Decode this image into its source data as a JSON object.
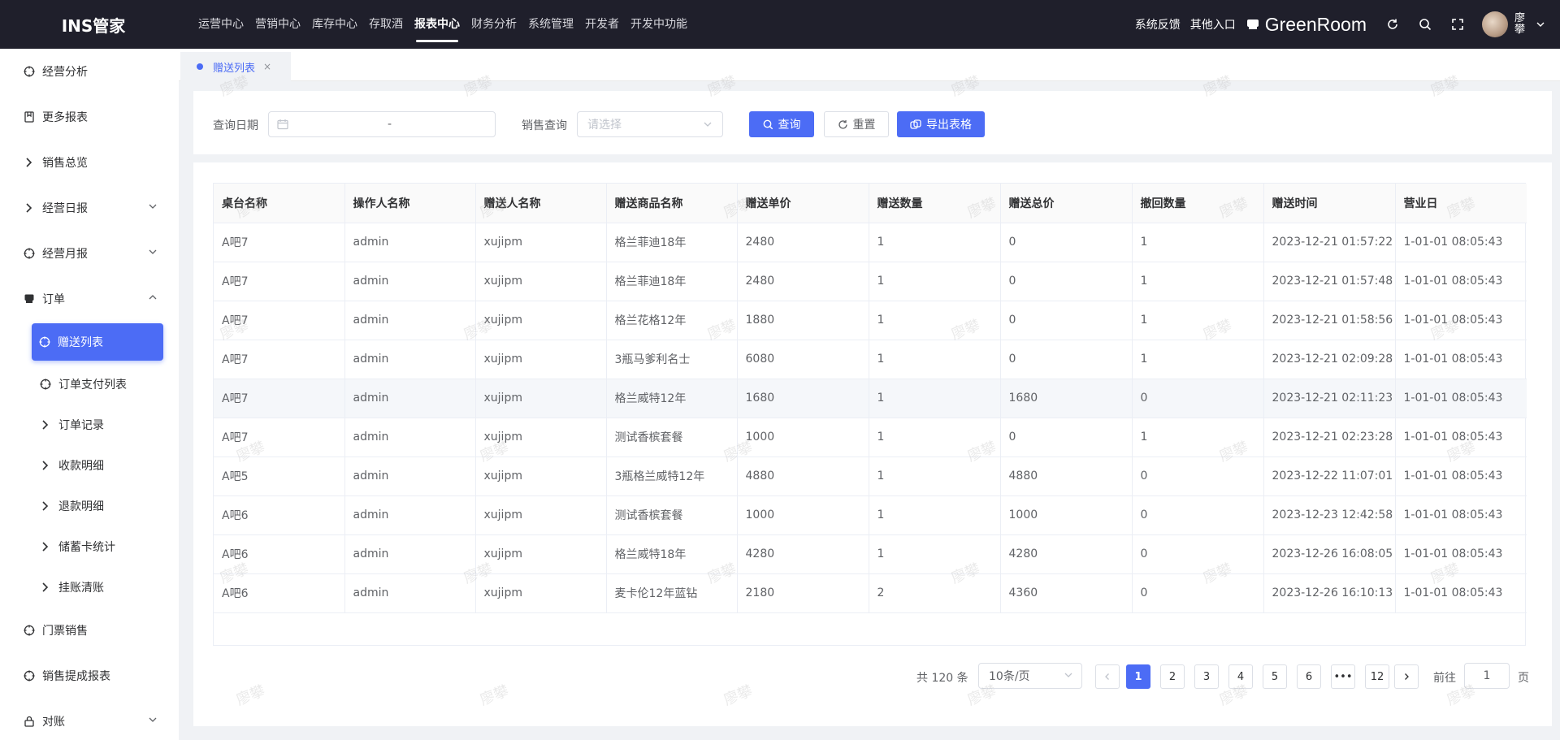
{
  "app": {
    "logo": "INS管家"
  },
  "topnav": [
    "运营中心",
    "营销中心",
    "库存中心",
    "存取酒",
    "报表中心",
    "财务分析",
    "系统管理",
    "开发者",
    "开发中功能"
  ],
  "topnav_active": "报表中心",
  "topright": {
    "feedback": "系统反馈",
    "other_entry": "其他入口",
    "store_name": "GreenRoom",
    "user_name": "廖攀"
  },
  "sidebar": {
    "items": [
      {
        "label": "经营分析",
        "icon": "target-icon"
      },
      {
        "label": "更多报表",
        "icon": "bookmark-icon"
      },
      {
        "label": "销售总览",
        "icon": "chevron-right-icon"
      },
      {
        "label": "经营日报",
        "icon": "chevron-right-icon",
        "arrow": "down"
      },
      {
        "label": "经营月报",
        "icon": "target-icon",
        "arrow": "down"
      },
      {
        "label": "订单",
        "icon": "box-icon",
        "arrow": "up"
      },
      {
        "label": "赠送列表",
        "icon": "target-icon",
        "active": true
      },
      {
        "label": "订单支付列表",
        "icon": "target-icon"
      },
      {
        "label": "订单记录",
        "icon": "chevron-right-icon"
      },
      {
        "label": "收款明细",
        "icon": "chevron-right-icon"
      },
      {
        "label": "退款明细",
        "icon": "chevron-right-icon"
      },
      {
        "label": "储蓄卡统计",
        "icon": "chevron-right-icon"
      },
      {
        "label": "挂账清账",
        "icon": "chevron-right-icon"
      },
      {
        "label": "门票销售",
        "icon": "target-icon"
      },
      {
        "label": "销售提成报表",
        "icon": "target-icon"
      },
      {
        "label": "对账",
        "icon": "lock-icon",
        "arrow": "down"
      }
    ]
  },
  "tabs": [
    {
      "label": "赠送列表",
      "close": "×"
    }
  ],
  "filter": {
    "date_label": "查询日期",
    "date_separator": "-",
    "sales_label": "销售查询",
    "sales_placeholder": "请选择",
    "query_button": "查询",
    "reset_button": "重置",
    "export_button": "导出表格"
  },
  "table": {
    "columns": [
      "桌台名称",
      "操作人名称",
      "赠送人名称",
      "赠送商品名称",
      "赠送单价",
      "赠送数量",
      "赠送总价",
      "撤回数量",
      "赠送时间",
      "营业日"
    ],
    "rows": [
      [
        "A吧7",
        "admin",
        "xujipm",
        "格兰菲迪18年",
        "2480",
        "1",
        "0",
        "1",
        "2023-12-21 01:57:22",
        "1-01-01 08:05:43"
      ],
      [
        "A吧7",
        "admin",
        "xujipm",
        "格兰菲迪18年",
        "2480",
        "1",
        "0",
        "1",
        "2023-12-21 01:57:48",
        "1-01-01 08:05:43"
      ],
      [
        "A吧7",
        "admin",
        "xujipm",
        "格兰花格12年",
        "1880",
        "1",
        "0",
        "1",
        "2023-12-21 01:58:56",
        "1-01-01 08:05:43"
      ],
      [
        "A吧7",
        "admin",
        "xujipm",
        "3瓶马爹利名士",
        "6080",
        "1",
        "0",
        "1",
        "2023-12-21 02:09:28",
        "1-01-01 08:05:43"
      ],
      [
        "A吧7",
        "admin",
        "xujipm",
        "格兰威特12年",
        "1680",
        "1",
        "1680",
        "0",
        "2023-12-21 02:11:23",
        "1-01-01 08:05:43"
      ],
      [
        "A吧7",
        "admin",
        "xujipm",
        "测试香槟套餐",
        "1000",
        "1",
        "0",
        "1",
        "2023-12-21 02:23:28",
        "1-01-01 08:05:43"
      ],
      [
        "A吧5",
        "admin",
        "xujipm",
        "3瓶格兰威特12年",
        "4880",
        "1",
        "4880",
        "0",
        "2023-12-22 11:07:01",
        "1-01-01 08:05:43"
      ],
      [
        "A吧6",
        "admin",
        "xujipm",
        "测试香槟套餐",
        "1000",
        "1",
        "1000",
        "0",
        "2023-12-23 12:42:58",
        "1-01-01 08:05:43"
      ],
      [
        "A吧6",
        "admin",
        "xujipm",
        "格兰威特18年",
        "4280",
        "1",
        "4280",
        "0",
        "2023-12-26 16:08:05",
        "1-01-01 08:05:43"
      ],
      [
        "A吧6",
        "admin",
        "xujipm",
        "麦卡伦12年蓝钻",
        "2180",
        "2",
        "4360",
        "0",
        "2023-12-26 16:10:13",
        "1-01-01 08:05:43"
      ]
    ],
    "hover_row": 4
  },
  "pagination": {
    "total": "共 120 条",
    "page_size": "10条/页",
    "pages": [
      "1",
      "2",
      "3",
      "4",
      "5",
      "6",
      "•••",
      "12"
    ],
    "current": "1",
    "goto_label": "前往",
    "goto_value": "1",
    "goto_suffix": "页"
  },
  "watermark": "廖攀",
  "colors": {
    "accent": "#4c6cf5",
    "topbar": "#1f1f2b"
  }
}
